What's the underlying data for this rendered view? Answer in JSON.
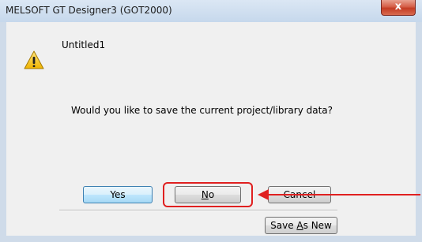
{
  "window": {
    "title": "MELSOFT GT Designer3 (GOT2000)",
    "close_icon": "close-icon"
  },
  "message": {
    "icon": "warning-icon",
    "document_name": "Untitled1",
    "question": "Would you like to save the current project/library data?"
  },
  "buttons": {
    "yes_label": "Yes",
    "no_label_prefix": "",
    "no_label_mnemonic": "N",
    "no_label_rest": "o",
    "cancel_label": "Cancel",
    "save_as_new_prefix": "Save ",
    "save_as_new_mnemonic": "A",
    "save_as_new_rest": "s New"
  },
  "annotation": {
    "highlight_color": "#e02020",
    "highlighted_button": "No",
    "arrow_color": "#e02020"
  }
}
